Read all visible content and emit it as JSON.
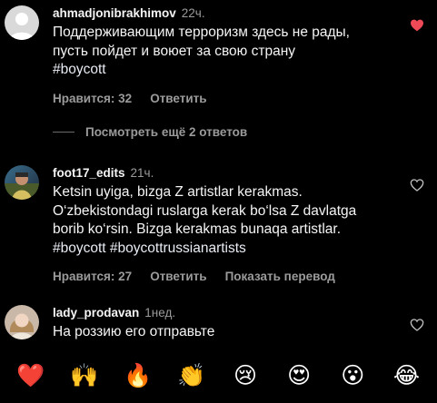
{
  "comments": [
    {
      "username": "ahmadjonibrakhimov",
      "time": "22ч.",
      "lines": [
        "Поддерживающим терроризм здесь не рады,",
        "пусть пойдет и воюет за свою страну"
      ],
      "hashtag_line": "#boycott",
      "likes_label": "Нравится: 32",
      "reply_label": "Ответить",
      "liked": true
    },
    {
      "username": "foot17_edits",
      "time": "21ч.",
      "lines": [
        "Ketsin uyiga, bizga Z artistlar kerakmas.",
        "O‘zbekistondagi ruslarga kerak bo‘lsa Z davlatga",
        "borib ko‘rsin. Bizga kerakmas bunaqa artistlar."
      ],
      "hashtag_line": "#boycott #boycottrussianartists",
      "likes_label": "Нравится: 27",
      "reply_label": "Ответить",
      "translate_label": "Показать перевод",
      "liked": false
    },
    {
      "username": "lady_prodavan",
      "time": "1нед.",
      "lines": [
        "На роззию его отправьте"
      ],
      "liked": false
    }
  ],
  "view_replies_label": "Посмотреть ещё 2 ответов",
  "emoji_bar": [
    "❤️",
    "🙌",
    "🔥",
    "👏",
    "😢",
    "😍",
    "😮",
    "😂"
  ],
  "colors": {
    "background": "#000000",
    "liked_heart": "#ed4956",
    "secondary_text": "#9b9b9b"
  },
  "icons": {
    "like_filled": "heart-filled-icon",
    "like_outline": "heart-outline-icon"
  }
}
